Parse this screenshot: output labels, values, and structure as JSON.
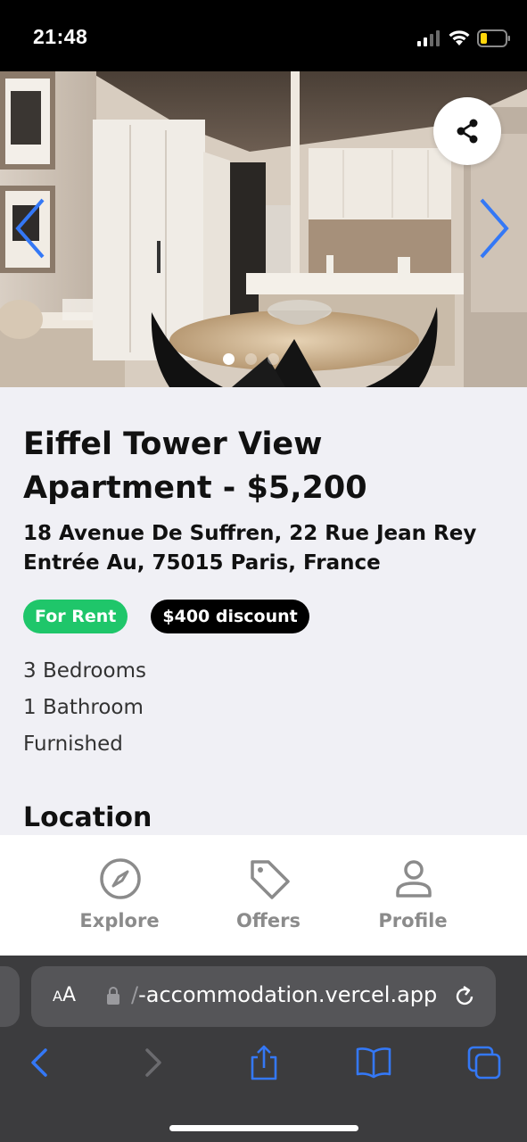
{
  "status_bar": {
    "time": "21:48"
  },
  "listing": {
    "title": "Eiffel Tower View Apartment - $5,200",
    "address": "18 Avenue De Suffren, 22 Rue Jean Rey Entrée Au, 75015 Paris, France",
    "badges": {
      "rent": "For Rent",
      "discount": "$400 discount"
    },
    "features": [
      "3 Bedrooms",
      "1 Bathroom",
      "Furnished"
    ],
    "location_heading": "Location"
  },
  "carousel": {
    "total_slides": 3,
    "active_slide": 1
  },
  "tabbar": {
    "explore": "Explore",
    "offers": "Offers",
    "profile": "Profile"
  },
  "browser": {
    "aa_small": "A",
    "aa_big": "A",
    "url_prefix": "/",
    "url": "-accommodation.vercel.app"
  },
  "colors": {
    "rent_badge": "#1fc66a",
    "discount_badge": "#000000",
    "accent_blue": "#3478f6",
    "tab_inactive": "#8b8b8b"
  },
  "icons": {
    "share": "share-icon",
    "explore": "compass-icon",
    "offers": "tag-icon",
    "profile": "person-icon"
  }
}
